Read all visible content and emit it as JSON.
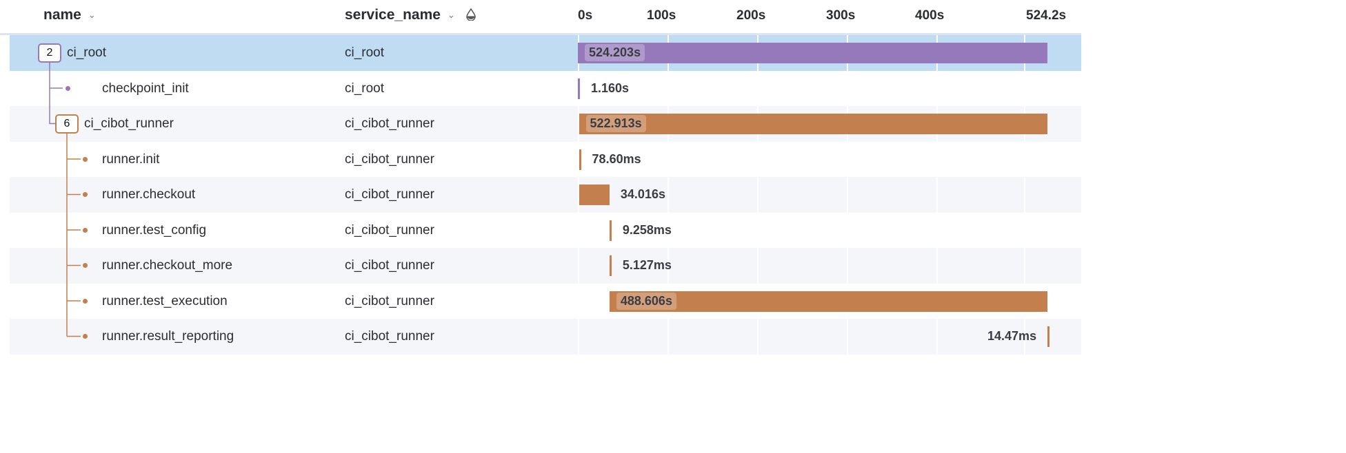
{
  "header": {
    "name_label": "name",
    "service_label": "service_name",
    "ticks": [
      "0s",
      "100s",
      "200s",
      "300s",
      "400s",
      "524.2s"
    ]
  },
  "timeline": {
    "max_seconds": 524.2,
    "tick_values": [
      0,
      100,
      200,
      300,
      400
    ]
  },
  "colors": {
    "ci_root": "#9679bb",
    "ci_cibot_runner": "#c47f4e",
    "selected_row": "#bfdcf3"
  },
  "rows": [
    {
      "name": "ci_root",
      "service": "ci_root",
      "depth": 0,
      "child_count": "2",
      "start_s": 0,
      "duration_s": 524.203,
      "duration_label": "524.203s",
      "selected": true
    },
    {
      "name": "checkpoint_init",
      "service": "ci_root",
      "depth": 1,
      "start_s": 0,
      "duration_s": 1.16,
      "duration_label": "1.160s"
    },
    {
      "name": "ci_cibot_runner",
      "service": "ci_cibot_runner",
      "depth": 1,
      "child_count": "6",
      "start_s": 1.2,
      "duration_s": 522.913,
      "duration_label": "522.913s"
    },
    {
      "name": "runner.init",
      "service": "ci_cibot_runner",
      "depth": 2,
      "start_s": 1.2,
      "duration_s": 0.0786,
      "duration_label": "78.60ms"
    },
    {
      "name": "runner.checkout",
      "service": "ci_cibot_runner",
      "depth": 2,
      "start_s": 1.3,
      "duration_s": 34.016,
      "duration_label": "34.016s"
    },
    {
      "name": "runner.test_config",
      "service": "ci_cibot_runner",
      "depth": 2,
      "start_s": 35.3,
      "duration_s": 0.009258,
      "duration_label": "9.258ms"
    },
    {
      "name": "runner.checkout_more",
      "service": "ci_cibot_runner",
      "depth": 2,
      "start_s": 35.3,
      "duration_s": 0.005127,
      "duration_label": "5.127ms"
    },
    {
      "name": "runner.test_execution",
      "service": "ci_cibot_runner",
      "depth": 2,
      "start_s": 35.3,
      "duration_s": 488.606,
      "duration_label": "488.606s"
    },
    {
      "name": "runner.result_reporting",
      "service": "ci_cibot_runner",
      "depth": 2,
      "start_s": 523.9,
      "duration_s": 0.01447,
      "duration_label": "14.47ms"
    }
  ]
}
